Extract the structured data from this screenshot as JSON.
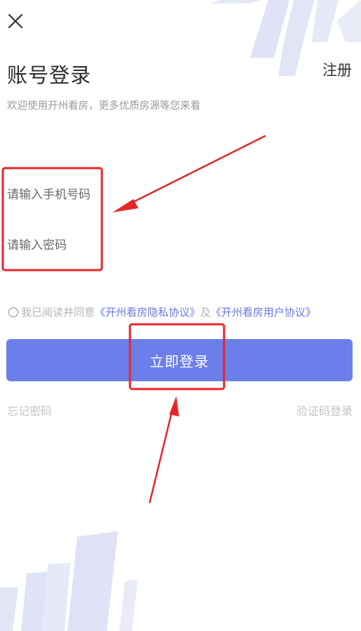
{
  "header": {
    "close_icon": "close-icon",
    "title": "账号登录",
    "register_label": "注册",
    "subtitle": "欢迎使用开州看房，更多优质房源等您来看"
  },
  "form": {
    "phone_placeholder": "请输入手机号码",
    "password_placeholder": "请输入密码"
  },
  "agreement": {
    "prefix": "我已阅读并同意",
    "privacy_link": "《开州看房隐私协议》",
    "conjunction": "及",
    "user_link": "《开州看房用户协议》"
  },
  "actions": {
    "login_label": "立即登录",
    "forgot_label": "忘记密码",
    "sms_login_label": "验证码登录"
  },
  "colors": {
    "primary": "#6b7ee9",
    "link": "#6a79df",
    "annotation": "#e8262a",
    "decoration": "#dfe3f5"
  }
}
